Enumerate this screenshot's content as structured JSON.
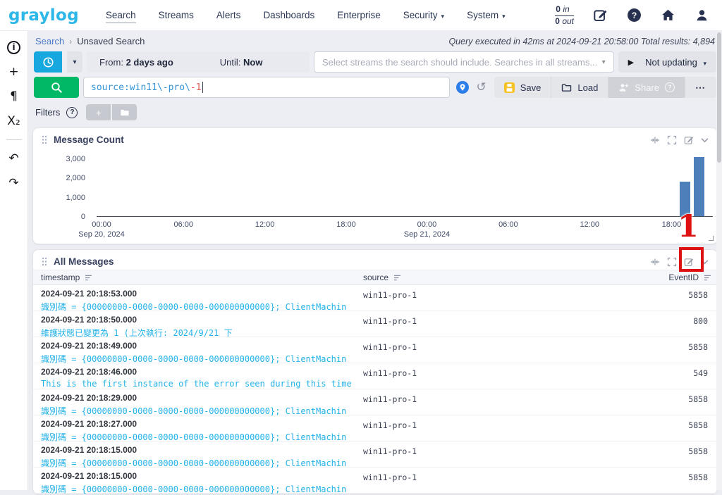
{
  "topnav": {
    "logo_text": "graylog",
    "items": [
      {
        "label": "Search",
        "active": true
      },
      {
        "label": "Streams"
      },
      {
        "label": "Alerts"
      },
      {
        "label": "Dashboards"
      },
      {
        "label": "Enterprise"
      },
      {
        "label": "Security",
        "has_menu": true
      },
      {
        "label": "System",
        "has_menu": true
      }
    ],
    "throughput": {
      "in_value": "0",
      "in_unit": "in",
      "out_value": "0",
      "out_unit": "out"
    }
  },
  "breadcrumb": {
    "root": "Search",
    "separator": "›",
    "current": "Unsaved Search"
  },
  "status_text": "Query executed in 42ms at 2024-09-21 20:58:00 Total results: 4,894",
  "timerange": {
    "from_label": "From:",
    "from_value": "2 days ago",
    "until_label": "Until:",
    "until_value": "Now"
  },
  "streams": {
    "placeholder": "Select streams the search should include. Searches in all streams..."
  },
  "refresh": {
    "label": "Not updating"
  },
  "query": {
    "highlighted": "source:win11\\-pro\\",
    "error_part": "-1"
  },
  "actions": {
    "save": "Save",
    "load": "Load",
    "share": "Share",
    "more": "⋯"
  },
  "filters": {
    "label": "Filters"
  },
  "icons": {
    "caret_down": "▾",
    "play": "▶",
    "history_arrow": "↺",
    "info_i": "i",
    "help_q": "?",
    "plus": "+",
    "pilcrow": "¶",
    "subscript_x": "X₂",
    "undo_arrow": "↶",
    "redo_arrow": "↷"
  },
  "widgets": {
    "message_count": {
      "title": "Message Count",
      "chart_data": {
        "type": "bar",
        "title": "Message Count",
        "x": [
          "2024-09-21 19:00",
          "2024-09-21 20:00"
        ],
        "values": [
          1800,
          3090
        ],
        "xlabel": "",
        "ylabel": "",
        "ylim": [
          0,
          3200
        ],
        "x_range": [
          "2024-09-19 21:00",
          "2024-09-21 21:15"
        ],
        "grid": false,
        "legend": false,
        "bar_color": "#4d7fba",
        "y_ticks": [
          {
            "value": 0,
            "label": "0"
          },
          {
            "value": 1000,
            "label": "1,000"
          },
          {
            "value": 2000,
            "label": "2,000"
          },
          {
            "value": 3000,
            "label": "3,000"
          }
        ],
        "x_ticks": [
          {
            "frac": 0.008,
            "label": "00:00",
            "sub": "Sep 20, 2024"
          },
          {
            "frac": 0.141,
            "label": "06:00"
          },
          {
            "frac": 0.273,
            "label": "12:00"
          },
          {
            "frac": 0.405,
            "label": "18:00"
          },
          {
            "frac": 0.536,
            "label": "00:00",
            "sub": "Sep 21, 2024"
          },
          {
            "frac": 0.668,
            "label": "06:00"
          },
          {
            "frac": 0.8,
            "label": "12:00"
          },
          {
            "frac": 0.933,
            "label": "18:00"
          }
        ],
        "bars": [
          {
            "frac": 0.946,
            "value": 1800
          },
          {
            "frac": 0.969,
            "value": 3090
          }
        ]
      }
    },
    "all_messages": {
      "title": "All Messages",
      "columns": [
        "timestamp",
        "source",
        "EventID"
      ],
      "rows": [
        {
          "timestamp": "2024-09-21 20:18:53.000",
          "message": "識別碼 = {00000000-0000-0000-0000-000000000000}; ClientMachin",
          "source": "win11-pro-1",
          "event_id": "5858"
        },
        {
          "timestamp": "2024-09-21 20:18:50.000",
          "message": "維護狀態已變更為 1 (上次執行: 2024/9/21 下",
          "source": "win11-pro-1",
          "event_id": "800"
        },
        {
          "timestamp": "2024-09-21 20:18:49.000",
          "message": "識別碼 = {00000000-0000-0000-0000-000000000000}; ClientMachin",
          "source": "win11-pro-1",
          "event_id": "5858"
        },
        {
          "timestamp": "2024-09-21 20:18:46.000",
          "message": "This is the first instance of the error seen during this time pe",
          "source": "win11-pro-1",
          "event_id": "549"
        },
        {
          "timestamp": "2024-09-21 20:18:29.000",
          "message": "識別碼 = {00000000-0000-0000-0000-000000000000}; ClientMachin",
          "source": "win11-pro-1",
          "event_id": "5858"
        },
        {
          "timestamp": "2024-09-21 20:18:27.000",
          "message": "識別碼 = {00000000-0000-0000-0000-000000000000}; ClientMachin",
          "source": "win11-pro-1",
          "event_id": "5858"
        },
        {
          "timestamp": "2024-09-21 20:18:15.000",
          "message": "識別碼 = {00000000-0000-0000-0000-000000000000}; ClientMachin",
          "source": "win11-pro-1",
          "event_id": "5858"
        },
        {
          "timestamp": "2024-09-21 20:18:15.000",
          "message": "識別碼 = {00000000-0000-0000-0000-000000000000}; ClientMachin",
          "source": "win11-pro-1",
          "event_id": "5858"
        }
      ]
    }
  },
  "annotation": {
    "step": "1",
    "color": "#dd1111"
  },
  "colors": {
    "accent_cyan": "#17a8e0",
    "accent_green": "#00b865",
    "link_blue": "#4d79c8",
    "bar_blue": "#4d7fba",
    "message_cyan": "#22b2e9",
    "query_blue": "#3093d6",
    "query_error_red": "#e15654",
    "save_yellow": "#f6c326",
    "annotation_red": "#dd1111",
    "navy": "#27314f"
  }
}
